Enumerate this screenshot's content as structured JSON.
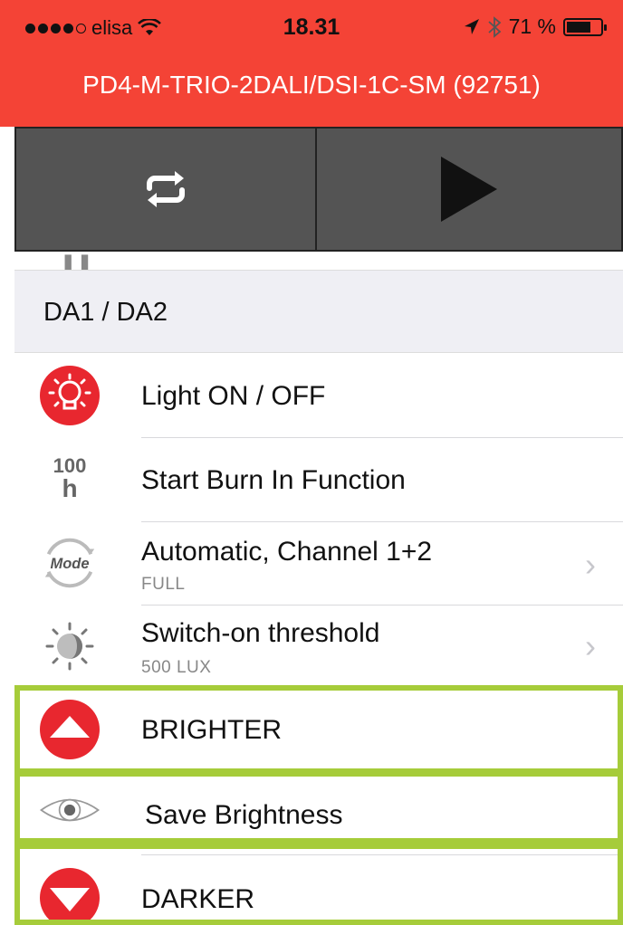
{
  "status_bar": {
    "carrier": "elisa",
    "time": "18.31",
    "battery": "71 %",
    "battery_level": 0.71,
    "icons": [
      "wifi-icon",
      "location-arrow-icon",
      "bluetooth-icon",
      "battery-icon"
    ]
  },
  "header": {
    "title": "PD4-M-TRIO-2DALI/DSI-1C-SM  (92751)",
    "color": "#f44336"
  },
  "toolbar": {
    "buttons": [
      {
        "icon": "repeat-icon"
      },
      {
        "icon": "play-icon"
      }
    ]
  },
  "section": {
    "title": "DA1  /  DA2"
  },
  "rows": [
    {
      "label": "Light ON / OFF",
      "icon": "light-bulb-icon"
    },
    {
      "label": "Start Burn In Function",
      "icon": "burn-in-100h-icon",
      "icon_text": "100",
      "icon_unit": "h"
    },
    {
      "label": "Automatic, Channel 1+2",
      "sub": "FULL",
      "icon": "mode-icon",
      "icon_text": "Mode"
    },
    {
      "label": "Switch-on threshold",
      "sub": "500 LUX",
      "icon": "sun-moon-icon"
    },
    {
      "label": "BRIGHTER",
      "icon": "arrow-up-icon"
    },
    {
      "label": "Save Brightness",
      "icon": "eye-icon"
    },
    {
      "label": "DARKER",
      "icon": "arrow-down-icon"
    }
  ],
  "colors": {
    "accent": "#f44336",
    "toolbar": "#545454",
    "highlight": "#a6cc3a"
  }
}
